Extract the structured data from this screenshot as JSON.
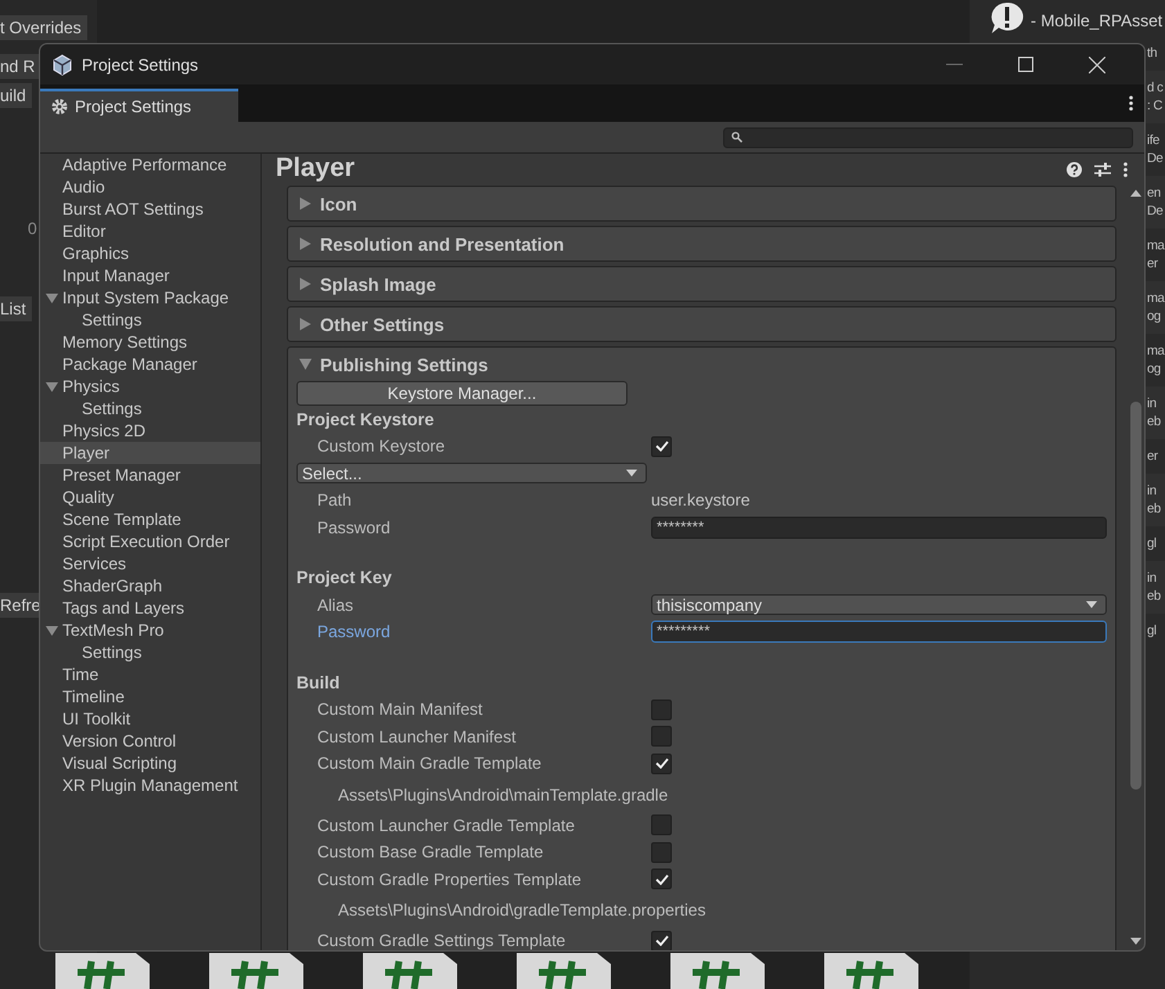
{
  "background": {
    "left_fragments": [
      "t Overrides",
      "nd R",
      "uild",
      "0",
      "List",
      "Refre"
    ],
    "console_header": "- Mobile_RPAsset",
    "console_fragments": [
      [
        "th"
      ],
      [
        "d c",
        ": C"
      ],
      [
        "ife",
        "De"
      ],
      [
        "en",
        "De"
      ],
      [
        "ma",
        "er"
      ],
      [
        "ma",
        "og"
      ],
      [
        "ma",
        "og"
      ],
      [
        "in",
        "eb"
      ],
      [
        "er"
      ],
      [
        "in",
        "eb"
      ],
      [
        "gl"
      ],
      [
        "in",
        "eb"
      ],
      [
        "gl"
      ]
    ]
  },
  "window": {
    "title": "Project Settings"
  },
  "tabs": [
    {
      "label": "Project Settings",
      "selected": true
    }
  ],
  "sidebar": {
    "items": [
      {
        "label": "Adaptive Performance",
        "selected": false
      },
      {
        "label": "Audio",
        "selected": false
      },
      {
        "label": "Burst AOT Settings",
        "selected": false
      },
      {
        "label": "Editor",
        "selected": false
      },
      {
        "label": "Graphics",
        "selected": false
      },
      {
        "label": "Input Manager",
        "selected": false
      },
      {
        "label": "Input System Package",
        "selected": false,
        "expanded": true,
        "children": [
          {
            "label": "Settings",
            "selected": false
          }
        ]
      },
      {
        "label": "Memory Settings",
        "selected": false
      },
      {
        "label": "Package Manager",
        "selected": false
      },
      {
        "label": "Physics",
        "selected": false,
        "expanded": true,
        "children": [
          {
            "label": "Settings",
            "selected": false
          }
        ]
      },
      {
        "label": "Physics 2D",
        "selected": false
      },
      {
        "label": "Player",
        "selected": true
      },
      {
        "label": "Preset Manager",
        "selected": false
      },
      {
        "label": "Quality",
        "selected": false
      },
      {
        "label": "Scene Template",
        "selected": false
      },
      {
        "label": "Script Execution Order",
        "selected": false
      },
      {
        "label": "Services",
        "selected": false
      },
      {
        "label": "ShaderGraph",
        "selected": false
      },
      {
        "label": "Tags and Layers",
        "selected": false
      },
      {
        "label": "TextMesh Pro",
        "selected": false,
        "expanded": true,
        "children": [
          {
            "label": "Settings",
            "selected": false
          }
        ]
      },
      {
        "label": "Time",
        "selected": false
      },
      {
        "label": "Timeline",
        "selected": false
      },
      {
        "label": "UI Toolkit",
        "selected": false
      },
      {
        "label": "Version Control",
        "selected": false
      },
      {
        "label": "Visual Scripting",
        "selected": false
      },
      {
        "label": "XR Plugin Management",
        "selected": false
      }
    ]
  },
  "content": {
    "title": "Player",
    "sections": [
      {
        "label": "Icon",
        "expanded": false
      },
      {
        "label": "Resolution and Presentation",
        "expanded": false
      },
      {
        "label": "Splash Image",
        "expanded": false
      },
      {
        "label": "Other Settings",
        "expanded": false
      },
      {
        "label": "Publishing Settings",
        "expanded": true,
        "rows": [
          {
            "kind": "button",
            "label": "Keystore Manager..."
          },
          {
            "kind": "heading",
            "label": "Project Keystore"
          },
          {
            "kind": "checkbox",
            "label": "Custom Keystore",
            "checked": true
          },
          {
            "kind": "dropdown",
            "value": "Select..."
          },
          {
            "kind": "text",
            "label": "Path",
            "value": "user.keystore"
          },
          {
            "kind": "password",
            "label": "Password",
            "value": "********",
            "focused": false
          },
          {
            "kind": "heading",
            "label": "Project Key"
          },
          {
            "kind": "select",
            "label": "Alias",
            "value": "thisiscompany"
          },
          {
            "kind": "password",
            "label": "Password",
            "value": "*********",
            "focused": true
          },
          {
            "kind": "heading",
            "label": "Build"
          },
          {
            "kind": "checkbox",
            "label": "Custom Main Manifest",
            "checked": false
          },
          {
            "kind": "checkbox",
            "label": "Custom Launcher Manifest",
            "checked": false
          },
          {
            "kind": "checkbox",
            "label": "Custom Main Gradle Template",
            "checked": true
          },
          {
            "kind": "path",
            "value": "Assets\\Plugins\\Android\\mainTemplate.gradle"
          },
          {
            "kind": "checkbox",
            "label": "Custom Launcher Gradle Template",
            "checked": false
          },
          {
            "kind": "checkbox",
            "label": "Custom Base Gradle Template",
            "checked": false
          },
          {
            "kind": "checkbox",
            "label": "Custom Gradle Properties Template",
            "checked": true
          },
          {
            "kind": "path",
            "value": "Assets\\Plugins\\Android\\gradleTemplate.properties"
          },
          {
            "kind": "checkbox",
            "label": "Custom Gradle Settings Template",
            "checked": true
          }
        ]
      }
    ]
  }
}
